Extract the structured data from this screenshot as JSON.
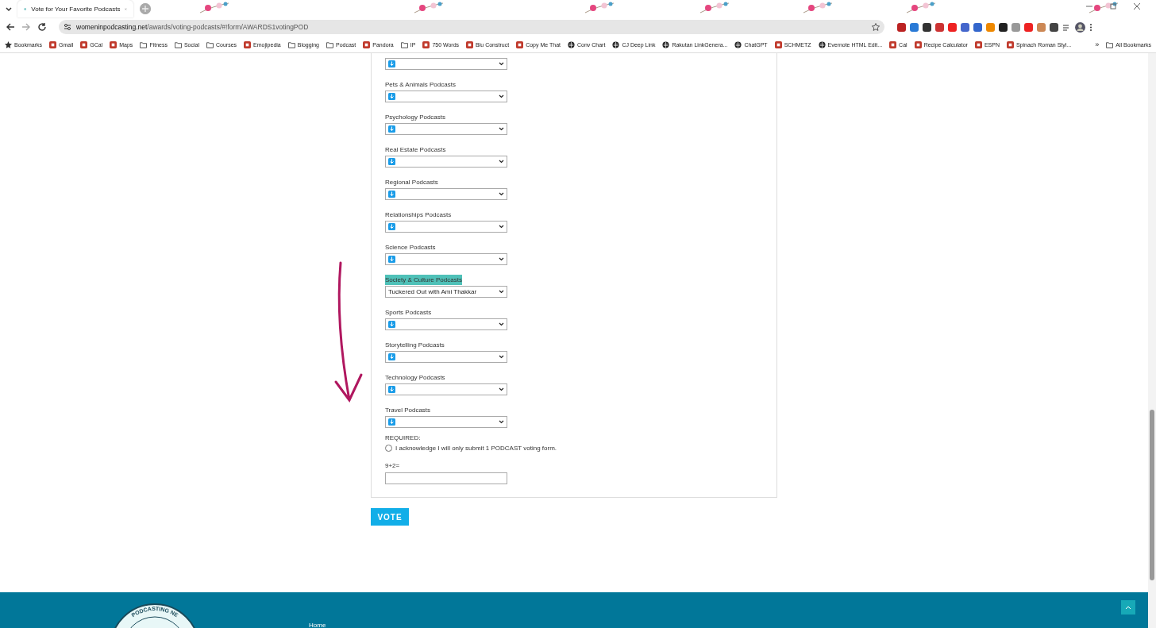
{
  "browser": {
    "tab": {
      "title": "Vote for Your Favorite Podcasts"
    },
    "url": {
      "host": "womeninpodcasting.net",
      "path": "/awards/voting-podcasts/#!form/AWARDS1votingPOD"
    },
    "bookmarks": [
      {
        "label": "Bookmarks",
        "kind": "star"
      },
      {
        "label": "Gmail",
        "kind": "site"
      },
      {
        "label": "GCal",
        "kind": "site"
      },
      {
        "label": "Maps",
        "kind": "site"
      },
      {
        "label": "Fitness",
        "kind": "folder"
      },
      {
        "label": "Social",
        "kind": "folder"
      },
      {
        "label": "Courses",
        "kind": "folder"
      },
      {
        "label": "Emojipedia",
        "kind": "site"
      },
      {
        "label": "Blogging",
        "kind": "folder"
      },
      {
        "label": "Podcast",
        "kind": "folder"
      },
      {
        "label": "Pandora",
        "kind": "site"
      },
      {
        "label": "IP",
        "kind": "folder"
      },
      {
        "label": "750 Words",
        "kind": "site"
      },
      {
        "label": "Blu Construct",
        "kind": "site"
      },
      {
        "label": "Copy Me That",
        "kind": "site"
      },
      {
        "label": "Conv Chart",
        "kind": "globe"
      },
      {
        "label": "CJ Deep Link",
        "kind": "globe"
      },
      {
        "label": "Rakutan LinkGenera...",
        "kind": "globe"
      },
      {
        "label": "ChatGPT",
        "kind": "globe"
      },
      {
        "label": "SCHMETZ",
        "kind": "site"
      },
      {
        "label": "Evernote HTML Edit...",
        "kind": "globe"
      },
      {
        "label": "Cal",
        "kind": "site"
      },
      {
        "label": "Recipe Calculator",
        "kind": "site"
      },
      {
        "label": "ESPN",
        "kind": "site"
      },
      {
        "label": "Spinach Roman Styl...",
        "kind": "site"
      }
    ],
    "more_bookmarks": "»",
    "all_bookmarks": "All Bookmarks"
  },
  "form": {
    "fields": [
      {
        "highlighted": false
      },
      {
        "label": "Pets & Animals Podcasts",
        "highlighted": false
      },
      {
        "label": "Psychology Podcasts",
        "highlighted": false
      },
      {
        "label": "Real Estate Podcasts",
        "highlighted": false
      },
      {
        "label": "Regional Podcasts",
        "highlighted": false
      },
      {
        "label": "Relationships Podcasts",
        "highlighted": false
      },
      {
        "label": "Science Podcasts",
        "highlighted": false
      },
      {
        "label": "Society & Culture Podcasts",
        "value": "Tuckered Out with Ami Thakkar",
        "highlighted": true
      },
      {
        "label": "Sports Podcasts",
        "highlighted": false
      },
      {
        "label": "Storytelling Podcasts",
        "highlighted": false
      },
      {
        "label": "Technology Podcasts",
        "highlighted": false
      },
      {
        "label": "Travel Podcasts",
        "highlighted": false
      }
    ],
    "required_label": "REQUIRED:",
    "acknowledge": {
      "label": "I acknowledge I will only submit 1 PODCAST voting form.",
      "checked": false
    },
    "captcha_label": "9+2="
  },
  "vote_button": "VOTE",
  "footer": {
    "logo_text": "PODCASTING NE",
    "nav": [
      "Home"
    ]
  }
}
